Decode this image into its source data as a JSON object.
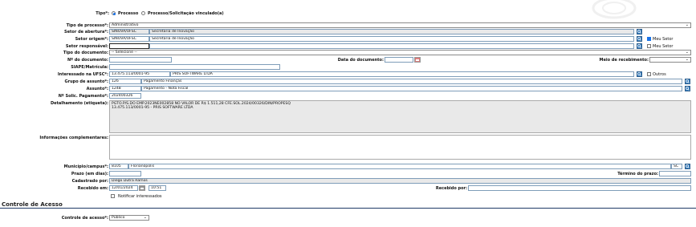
{
  "tipo": {
    "label": "Tipo*:",
    "opt1": "Processo",
    "opt2": "Processo/Solicitação vinculado(a)"
  },
  "tipo_processo": {
    "label": "Tipo de processo*:",
    "value": "Administrativo"
  },
  "setor_abertura": {
    "label": "Setor de abertura*:",
    "sigla": "SINOVA/UFSC",
    "nome": "Secretaria de Inovação"
  },
  "setor_origem": {
    "label": "Setor origem*:",
    "sigla": "SINOVA/UFSC",
    "nome": "Secretaria de Inovação",
    "check": "Meu Setor"
  },
  "setor_responsavel": {
    "label": "Setor responsável:",
    "check": "Meu Setor"
  },
  "tipo_documento": {
    "label": "Tipo do documento:",
    "value": "-- Selecione --"
  },
  "num_documento": {
    "label": "Nº do documento:"
  },
  "data_documento": {
    "label": "Data do documento:"
  },
  "meio_recebimento": {
    "label": "Meio de recebimento:"
  },
  "siape": {
    "label": "SIAPE/Matrícula:"
  },
  "interessado": {
    "label": "Interessado na UFSC*:",
    "cnpj": "13.475.113/0001-95",
    "nome": "PRIS SOFTWARE LTDA",
    "check": "Outros"
  },
  "grupo_assunto": {
    "label": "Grupo de assunto*:",
    "codigo": "126",
    "nome": "Pagamento Finanças"
  },
  "assunto": {
    "label": "Assunto*:",
    "codigo": "1248",
    "nome": "Pagamento - Nota Fiscal"
  },
  "solic_pagamento": {
    "label": "Nº Solic. Pagamento*:",
    "value": "202400326"
  },
  "detalhamento": {
    "label": "Detalhamento (etiqueta):",
    "line1": "PGTO.P/S.DO EMP.2023NE002858 NO VALOR DE R$  1.511,28  CFE.SOL.2024/00326/DIN/PROPESQ",
    "line2": "13.475.113/0001-95 - PRIS SOFTWARE LTDA"
  },
  "info_complementares": {
    "label": "Informações complementares:"
  },
  "municipio": {
    "label": "Município/campus*:",
    "codigo": "8105",
    "nome": "Florianópolis",
    "uf": "SC"
  },
  "prazo": {
    "label": "Prazo (em dias):"
  },
  "termino_prazo": {
    "label": "Término do prazo:"
  },
  "cadastrado_por": {
    "label": "Cadastrado por:",
    "value": "Diego Dutra Ramos"
  },
  "recebido_em": {
    "label": "Recebido em:",
    "data": "12/01/2024",
    "hora": "10:51"
  },
  "recebido_por": {
    "label": "Recebido por:"
  },
  "notificar": {
    "label": "Notificar interessados"
  },
  "controle_acesso_section": {
    "title": "Controle de Acesso"
  },
  "controle_acesso": {
    "label": "Controle de acesso*:",
    "value": "Público"
  },
  "colors": {
    "accent": "#1a73e8",
    "search_button": "#3a7fbf",
    "readonly": "#e9e9e9"
  }
}
